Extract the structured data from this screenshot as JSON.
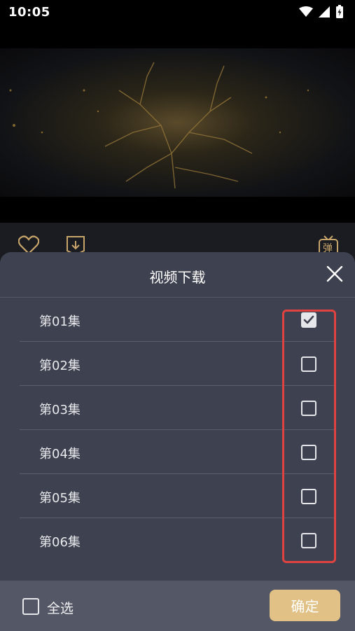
{
  "status_bar": {
    "time": "10:05"
  },
  "sheet": {
    "title": "视频下载"
  },
  "episodes": [
    {
      "label": "第01集",
      "checked": true
    },
    {
      "label": "第02集",
      "checked": false
    },
    {
      "label": "第03集",
      "checked": false
    },
    {
      "label": "第04集",
      "checked": false
    },
    {
      "label": "第05集",
      "checked": false
    },
    {
      "label": "第06集",
      "checked": false
    }
  ],
  "bottom": {
    "select_all_label": "全选",
    "confirm_label": "确定"
  },
  "player_actions": {
    "danmaku_label": "弹"
  },
  "colors": {
    "accent": "#e1c185",
    "sheet_bg": "#3e4250",
    "highlight": "#e0423f"
  }
}
